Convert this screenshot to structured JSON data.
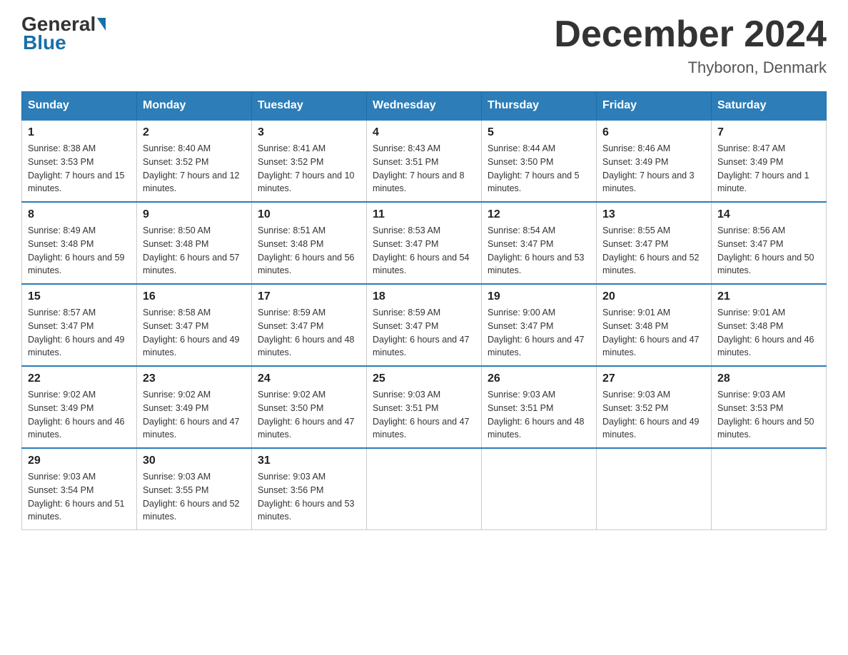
{
  "logo": {
    "general": "General",
    "blue": "Blue"
  },
  "title": "December 2024",
  "subtitle": "Thyboron, Denmark",
  "days_of_week": [
    "Sunday",
    "Monday",
    "Tuesday",
    "Wednesday",
    "Thursday",
    "Friday",
    "Saturday"
  ],
  "weeks": [
    [
      {
        "day": "1",
        "sunrise": "8:38 AM",
        "sunset": "3:53 PM",
        "daylight": "7 hours and 15 minutes."
      },
      {
        "day": "2",
        "sunrise": "8:40 AM",
        "sunset": "3:52 PM",
        "daylight": "7 hours and 12 minutes."
      },
      {
        "day": "3",
        "sunrise": "8:41 AM",
        "sunset": "3:52 PM",
        "daylight": "7 hours and 10 minutes."
      },
      {
        "day": "4",
        "sunrise": "8:43 AM",
        "sunset": "3:51 PM",
        "daylight": "7 hours and 8 minutes."
      },
      {
        "day": "5",
        "sunrise": "8:44 AM",
        "sunset": "3:50 PM",
        "daylight": "7 hours and 5 minutes."
      },
      {
        "day": "6",
        "sunrise": "8:46 AM",
        "sunset": "3:49 PM",
        "daylight": "7 hours and 3 minutes."
      },
      {
        "day": "7",
        "sunrise": "8:47 AM",
        "sunset": "3:49 PM",
        "daylight": "7 hours and 1 minute."
      }
    ],
    [
      {
        "day": "8",
        "sunrise": "8:49 AM",
        "sunset": "3:48 PM",
        "daylight": "6 hours and 59 minutes."
      },
      {
        "day": "9",
        "sunrise": "8:50 AM",
        "sunset": "3:48 PM",
        "daylight": "6 hours and 57 minutes."
      },
      {
        "day": "10",
        "sunrise": "8:51 AM",
        "sunset": "3:48 PM",
        "daylight": "6 hours and 56 minutes."
      },
      {
        "day": "11",
        "sunrise": "8:53 AM",
        "sunset": "3:47 PM",
        "daylight": "6 hours and 54 minutes."
      },
      {
        "day": "12",
        "sunrise": "8:54 AM",
        "sunset": "3:47 PM",
        "daylight": "6 hours and 53 minutes."
      },
      {
        "day": "13",
        "sunrise": "8:55 AM",
        "sunset": "3:47 PM",
        "daylight": "6 hours and 52 minutes."
      },
      {
        "day": "14",
        "sunrise": "8:56 AM",
        "sunset": "3:47 PM",
        "daylight": "6 hours and 50 minutes."
      }
    ],
    [
      {
        "day": "15",
        "sunrise": "8:57 AM",
        "sunset": "3:47 PM",
        "daylight": "6 hours and 49 minutes."
      },
      {
        "day": "16",
        "sunrise": "8:58 AM",
        "sunset": "3:47 PM",
        "daylight": "6 hours and 49 minutes."
      },
      {
        "day": "17",
        "sunrise": "8:59 AM",
        "sunset": "3:47 PM",
        "daylight": "6 hours and 48 minutes."
      },
      {
        "day": "18",
        "sunrise": "8:59 AM",
        "sunset": "3:47 PM",
        "daylight": "6 hours and 47 minutes."
      },
      {
        "day": "19",
        "sunrise": "9:00 AM",
        "sunset": "3:47 PM",
        "daylight": "6 hours and 47 minutes."
      },
      {
        "day": "20",
        "sunrise": "9:01 AM",
        "sunset": "3:48 PM",
        "daylight": "6 hours and 47 minutes."
      },
      {
        "day": "21",
        "sunrise": "9:01 AM",
        "sunset": "3:48 PM",
        "daylight": "6 hours and 46 minutes."
      }
    ],
    [
      {
        "day": "22",
        "sunrise": "9:02 AM",
        "sunset": "3:49 PM",
        "daylight": "6 hours and 46 minutes."
      },
      {
        "day": "23",
        "sunrise": "9:02 AM",
        "sunset": "3:49 PM",
        "daylight": "6 hours and 47 minutes."
      },
      {
        "day": "24",
        "sunrise": "9:02 AM",
        "sunset": "3:50 PM",
        "daylight": "6 hours and 47 minutes."
      },
      {
        "day": "25",
        "sunrise": "9:03 AM",
        "sunset": "3:51 PM",
        "daylight": "6 hours and 47 minutes."
      },
      {
        "day": "26",
        "sunrise": "9:03 AM",
        "sunset": "3:51 PM",
        "daylight": "6 hours and 48 minutes."
      },
      {
        "day": "27",
        "sunrise": "9:03 AM",
        "sunset": "3:52 PM",
        "daylight": "6 hours and 49 minutes."
      },
      {
        "day": "28",
        "sunrise": "9:03 AM",
        "sunset": "3:53 PM",
        "daylight": "6 hours and 50 minutes."
      }
    ],
    [
      {
        "day": "29",
        "sunrise": "9:03 AM",
        "sunset": "3:54 PM",
        "daylight": "6 hours and 51 minutes."
      },
      {
        "day": "30",
        "sunrise": "9:03 AM",
        "sunset": "3:55 PM",
        "daylight": "6 hours and 52 minutes."
      },
      {
        "day": "31",
        "sunrise": "9:03 AM",
        "sunset": "3:56 PM",
        "daylight": "6 hours and 53 minutes."
      },
      null,
      null,
      null,
      null
    ]
  ]
}
